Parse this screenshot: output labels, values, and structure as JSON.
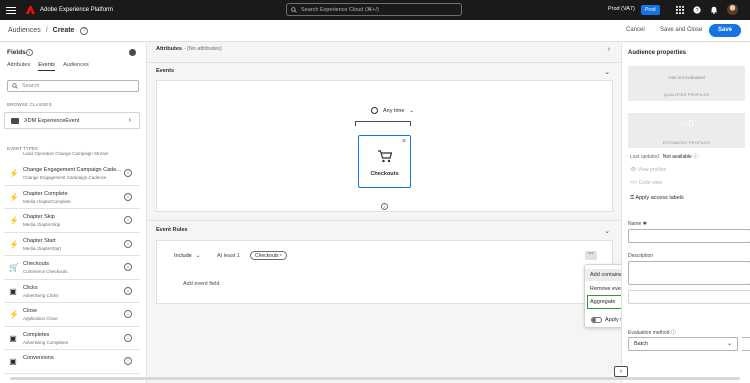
{
  "topbar": {
    "app_name": "Adobe Experience Platform",
    "search_placeholder": "Search Experience Cloud (⌘+/)",
    "org": "Prod (VA7)",
    "sandbox": "Prod"
  },
  "header": {
    "breadcrumb_parent": "Audiences",
    "separator": "/",
    "title": "Create",
    "cancel": "Cancel",
    "save_close": "Save and Close",
    "save": "Save"
  },
  "left": {
    "fields_title": "Fields",
    "tabs": [
      "Attributes",
      "Events",
      "Audiences"
    ],
    "search_placeholder": "Search",
    "browse_classes": "BROWSE CLASSES",
    "class_name": "XDM ExperienceEvent",
    "event_types_label": "EVENT TYPES",
    "cut_item": "Lead Operation Change Campaign Stream",
    "items": [
      {
        "name": "Change Engagement Campaign Cade...",
        "sub": "Change Engagement Campaign Cadence",
        "icon": "lightning-icon"
      },
      {
        "name": "Chapter Complete",
        "sub": "Media chapterComplete",
        "icon": "lightning-icon"
      },
      {
        "name": "Chapter Skip",
        "sub": "Media chapterSkip",
        "icon": "lightning-icon"
      },
      {
        "name": "Chapter Start",
        "sub": "Media chapterStart",
        "icon": "lightning-icon"
      },
      {
        "name": "Checkouts",
        "sub": "Commerce Checkouts",
        "icon": "cart-icon"
      },
      {
        "name": "Clicks",
        "sub": "Advertising Clicks",
        "icon": "ad-icon"
      },
      {
        "name": "Close",
        "sub": "Application Close",
        "icon": "lightning-icon"
      },
      {
        "name": "Completes",
        "sub": "Advertising Completes",
        "icon": "ad-icon"
      },
      {
        "name": "Conversions",
        "sub": "",
        "icon": "ad-icon"
      }
    ]
  },
  "center": {
    "attributes_label": "Attributes",
    "attributes_sub": " - (No attributes)",
    "events_label": "Events",
    "any_time": "Any time",
    "card_label": "Checkouts",
    "event_rules_label": "Event Rules",
    "include": "Include",
    "at_least": "At least 1",
    "chip": "Checkouts",
    "add_event_field": "Add event field"
  },
  "menu": {
    "add_container": "Add container",
    "remove_event_type": "Remove event type",
    "aggregate": "Aggregate",
    "apply_time_rule": "Apply time rule"
  },
  "right": {
    "title": "Audience properties",
    "not_evaluated": "Has not evaluated",
    "qualified": "QUALIFIED PROFILES",
    "estimated_value": "-- 0",
    "estimated": "ESTIMATED PROFILES",
    "last_updated_label": "Last updated",
    "last_updated_value": "Not available",
    "view_profiles": "View profiles",
    "code_view": "Code view",
    "apply_access": "Apply access labels",
    "name_label": "Name ✱",
    "description_label": "Description",
    "evaluation_label": "Evaluation method",
    "evaluation_value": "Batch"
  }
}
